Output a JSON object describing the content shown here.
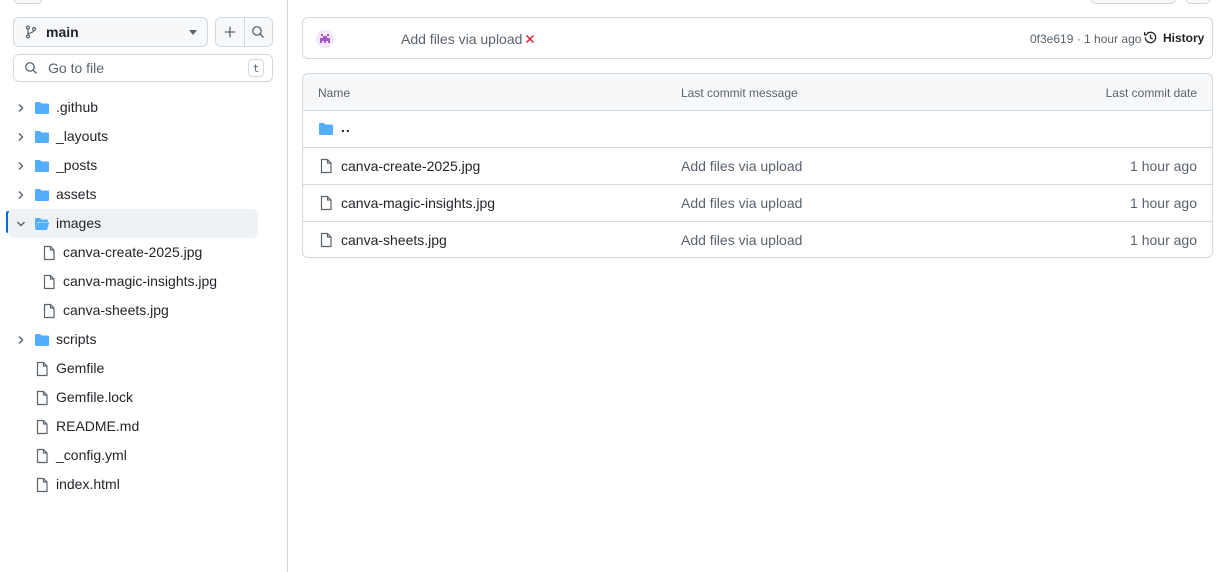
{
  "sidebar": {
    "branch": "main",
    "search_placeholder": "Go to file",
    "search_shortcut": "t",
    "tree": [
      {
        "label": ".github",
        "type": "folder",
        "level": 0,
        "expanded": false
      },
      {
        "label": "_layouts",
        "type": "folder",
        "level": 0,
        "expanded": false
      },
      {
        "label": "_posts",
        "type": "folder",
        "level": 0,
        "expanded": false
      },
      {
        "label": "assets",
        "type": "folder",
        "level": 0,
        "expanded": false
      },
      {
        "label": "images",
        "type": "folder",
        "level": 0,
        "expanded": true,
        "active": true
      },
      {
        "label": "canva-create-2025.jpg",
        "type": "file",
        "level": 1
      },
      {
        "label": "canva-magic-insights.jpg",
        "type": "file",
        "level": 1
      },
      {
        "label": "canva-sheets.jpg",
        "type": "file",
        "level": 1
      },
      {
        "label": "scripts",
        "type": "folder",
        "level": 0,
        "expanded": false
      },
      {
        "label": "Gemfile",
        "type": "file",
        "level": 0
      },
      {
        "label": "Gemfile.lock",
        "type": "file",
        "level": 0
      },
      {
        "label": "README.md",
        "type": "file",
        "level": 0
      },
      {
        "label": "_config.yml",
        "type": "file",
        "level": 0
      },
      {
        "label": "index.html",
        "type": "file",
        "level": 0
      }
    ]
  },
  "commit": {
    "message": "Add files via upload",
    "status": "failed",
    "meta": "0f3e619 · 1 hour ago",
    "history_label": "History"
  },
  "table": {
    "headers": {
      "name": "Name",
      "message": "Last commit message",
      "date": "Last commit date"
    },
    "parent_label": "..",
    "rows": [
      {
        "name": "canva-create-2025.jpg",
        "message": "Add files via upload",
        "date": "1 hour ago"
      },
      {
        "name": "canva-magic-insights.jpg",
        "message": "Add files via upload",
        "date": "1 hour ago"
      },
      {
        "name": "canva-sheets.jpg",
        "message": "Add files via upload",
        "date": "1 hour ago"
      }
    ]
  },
  "colors": {
    "folder": "#54aeff",
    "accent": "#0969da",
    "fail": "#d1242f",
    "border": "#d1d9e0",
    "muted": "#59636e"
  },
  "icons": {
    "branch": "git-branch-icon",
    "plus": "plus-icon",
    "search": "search-icon",
    "folder": "folder-icon",
    "file": "file-icon",
    "chevron_right": "chevron-right-icon",
    "chevron_down": "chevron-down-icon",
    "history": "history-icon",
    "fail": "x-icon"
  }
}
